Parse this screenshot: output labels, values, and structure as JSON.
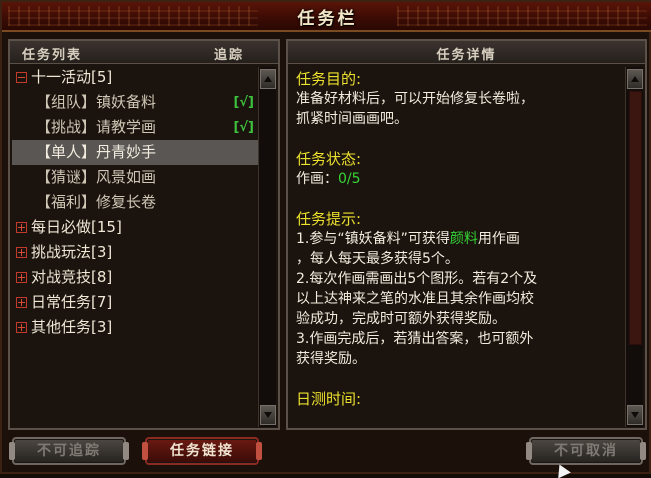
{
  "window": {
    "title": "任务栏"
  },
  "left_panel": {
    "header_list": "任务列表",
    "header_track": "追踪",
    "tree": [
      {
        "type": "category",
        "expanded": true,
        "label": "十一活动[5]"
      },
      {
        "type": "task",
        "label": "【组队】镇妖备料",
        "tracked": true,
        "check": "[√]"
      },
      {
        "type": "task",
        "label": "【挑战】请教学画",
        "tracked": true,
        "check": "[√]"
      },
      {
        "type": "task",
        "label": "【单人】丹青妙手",
        "selected": true
      },
      {
        "type": "task",
        "label": "【猜谜】风景如画"
      },
      {
        "type": "task",
        "label": "【福利】修复长卷"
      },
      {
        "type": "category",
        "expanded": false,
        "label": "每日必做[15]"
      },
      {
        "type": "category",
        "expanded": false,
        "label": "挑战玩法[3]"
      },
      {
        "type": "category",
        "expanded": false,
        "label": "对战竞技[8]"
      },
      {
        "type": "category",
        "expanded": false,
        "label": "日常任务[7]"
      },
      {
        "type": "category",
        "expanded": false,
        "label": "其他任务[3]"
      }
    ]
  },
  "right_panel": {
    "header": "任务详情",
    "goal_title": "任务目的:",
    "goal_line1": "准备好材料后，可以开始修复长卷啦，",
    "goal_line2": "抓紧时间画画吧。",
    "status_title": "任务状态:",
    "status_label": "作画：",
    "status_value": "0/5",
    "tips_title": "任务提示:",
    "tip1_a": "1.参与“镇妖备料”可获得",
    "tip1_highlight": "颜料",
    "tip1_b": "用作画",
    "tip1_c": "，每人每天最多获得5个。",
    "tip2_a": "2.每次作画需画出5个图形。若有2个及",
    "tip2_b": "以上达神来之笔的水准且其余作画均校",
    "tip2_c": "验成功，完成时可额外获得奖励。",
    "tip3_a": "3.作画完成后，若猜出答案，也可额外",
    "tip3_b": "获得奖励。",
    "time_title": "日测时间:"
  },
  "buttons": {
    "untrack": "不可追踪",
    "task_link": "任务链接",
    "cancel": "不可取消"
  },
  "colors": {
    "accent_red": "#6a1a12",
    "heading_yellow": "#ece02e",
    "value_green": "#35d535"
  }
}
